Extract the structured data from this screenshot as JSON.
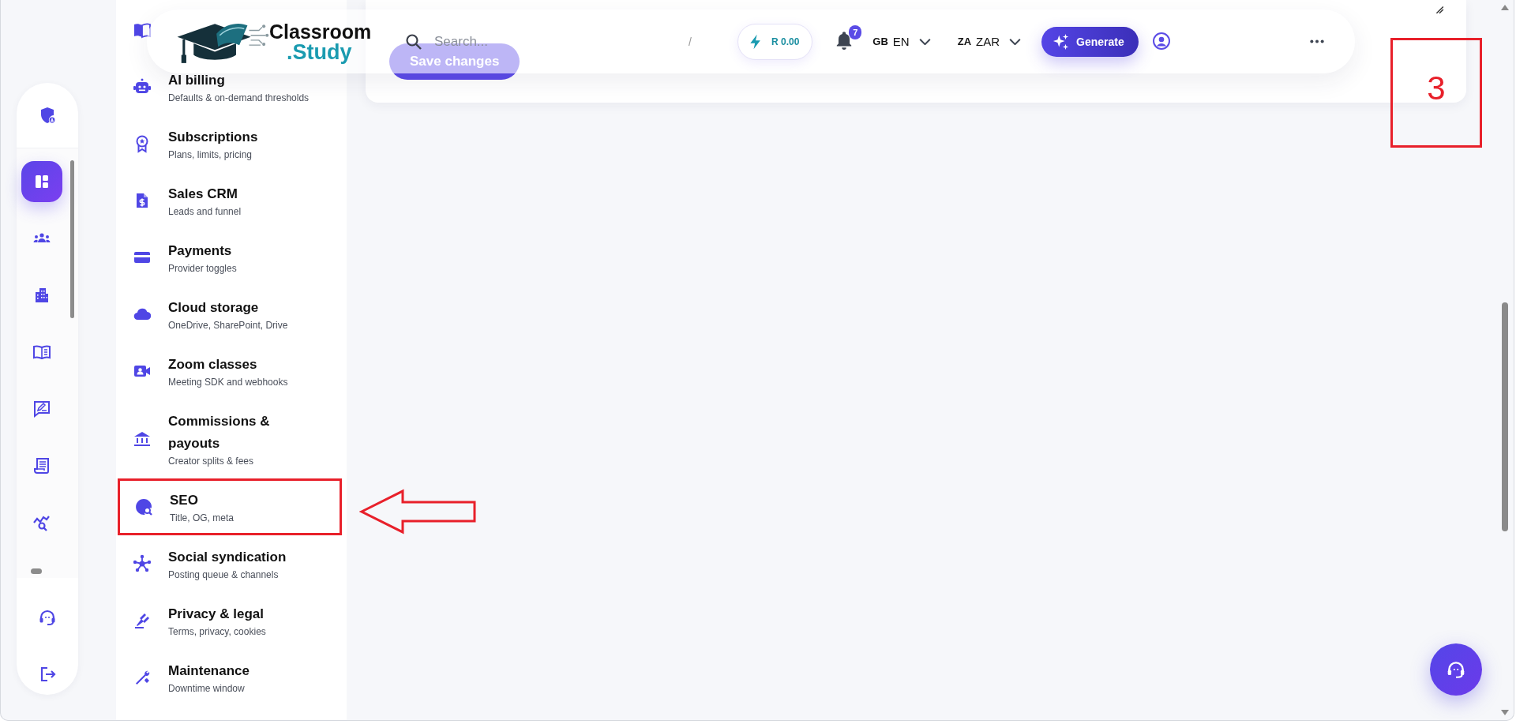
{
  "topbar": {
    "logo": {
      "line_1": "Classroom",
      "line_2": ".Study"
    },
    "search": {
      "placeholder": "Search..."
    },
    "shortcut": "/",
    "balance": "R 0.00",
    "notifications": "7",
    "language": {
      "flag": "GB",
      "code": "EN"
    },
    "currency": {
      "flag": "ZA",
      "code": "ZAR"
    },
    "generate": "Generate"
  },
  "rail": {
    "top": [
      {
        "selected": false
      }
    ],
    "scroll": [
      {
        "selected": true
      },
      {
        "selected": false
      },
      {
        "selected": false
      },
      {
        "selected": false
      },
      {
        "selected": false
      },
      {
        "selected": false
      },
      {
        "selected": false
      }
    ],
    "bottom": [
      {
        "selected": false
      },
      {
        "selected": false
      }
    ]
  },
  "menu": [
    {
      "annotated": false
    },
    {
      "title": "AI billing",
      "subtitle": "Defaults & on-demand thresholds",
      "annotated": false
    },
    {
      "title": "Subscriptions",
      "subtitle": "Plans, limits, pricing",
      "annotated": false
    },
    {
      "title": "Sales CRM",
      "subtitle": "Leads and funnel",
      "annotated": false
    },
    {
      "title": "Payments",
      "subtitle": "Provider toggles",
      "annotated": false
    },
    {
      "title": "Cloud storage",
      "subtitle": "OneDrive, SharePoint, Drive",
      "annotated": false
    },
    {
      "title": "Zoom classes",
      "subtitle": "Meeting SDK and webhooks",
      "annotated": false
    },
    {
      "title": "Commissions & payouts",
      "subtitle": "Creator splits & fees",
      "annotated": false
    },
    {
      "title": "SEO",
      "subtitle": "Title, OG, meta",
      "annotated": true
    },
    {
      "title": "Social syndication",
      "subtitle": "Posting queue & channels",
      "annotated": false
    },
    {
      "title": "Privacy & legal",
      "subtitle": "Terms, privacy, cookies",
      "annotated": false
    },
    {
      "title": "Maintenance",
      "subtitle": "Downtime window",
      "annotated": false
    }
  ],
  "content": {
    "save_button": "Save changes"
  },
  "annotation": {
    "label": "3"
  }
}
